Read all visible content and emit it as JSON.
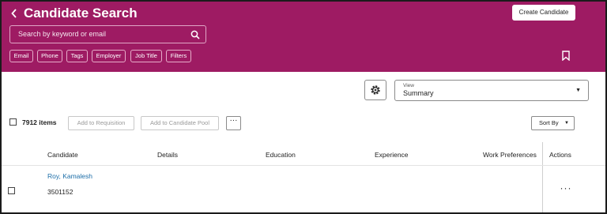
{
  "header": {
    "title": "Candidate Search",
    "back_icon": "chevron-left-icon",
    "create_button": "Create Candidate",
    "background_color": "#9e1b63",
    "search": {
      "placeholder": "Search by keyword or email",
      "icon": "search-icon"
    },
    "filter_chips": [
      "Email",
      "Phone",
      "Tags",
      "Employer",
      "Job Title",
      "Filters"
    ],
    "bookmark_icon": "bookmark-icon"
  },
  "view_controls": {
    "settings_icon": "gear-icon",
    "view_label": "View",
    "view_value": "Summary"
  },
  "toolbar": {
    "item_count": "7912 items",
    "add_to_requisition": "Add to Requisition",
    "add_to_pool": "Add to Candidate Pool",
    "more_icon": "more-horizontal-icon",
    "sort_by": "Sort By"
  },
  "table": {
    "columns": [
      "Candidate",
      "Details",
      "Education",
      "Experience",
      "Work Preferences",
      "Actions"
    ],
    "rows": [
      {
        "name": "Roy, Kamalesh",
        "id": "3501152"
      }
    ]
  }
}
